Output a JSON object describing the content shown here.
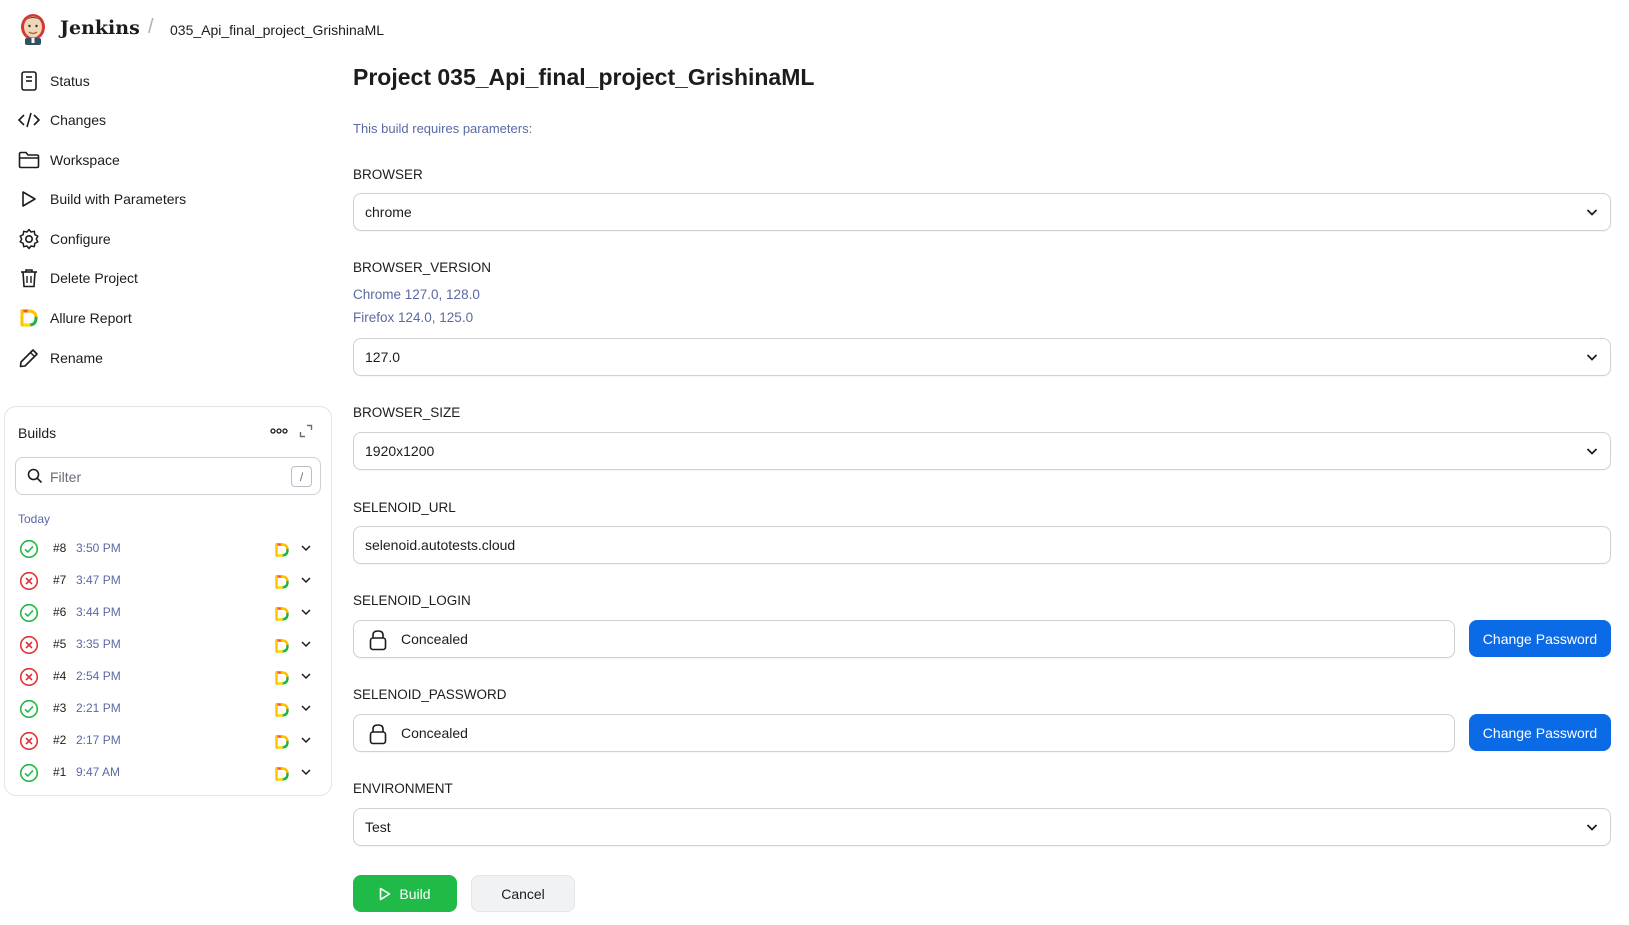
{
  "header": {
    "brand": "Jenkins",
    "breadcrumb_separator": "/",
    "breadcrumb": "035_Api_final_project_GrishinaML"
  },
  "sidebar": {
    "items": [
      {
        "label": "Status",
        "icon": "document-icon"
      },
      {
        "label": "Changes",
        "icon": "code-icon"
      },
      {
        "label": "Workspace",
        "icon": "folder-icon"
      },
      {
        "label": "Build with Parameters",
        "icon": "play-icon"
      },
      {
        "label": "Configure",
        "icon": "gear-icon"
      },
      {
        "label": "Delete Project",
        "icon": "trash-icon"
      },
      {
        "label": "Allure Report",
        "icon": "allure-icon"
      },
      {
        "label": "Rename",
        "icon": "pencil-icon"
      }
    ]
  },
  "builds": {
    "title": "Builds",
    "filter_placeholder": "Filter",
    "filter_shortcut": "/",
    "group_label": "Today",
    "items": [
      {
        "number": "#8",
        "time": "3:50 PM",
        "status": "success"
      },
      {
        "number": "#7",
        "time": "3:47 PM",
        "status": "failed"
      },
      {
        "number": "#6",
        "time": "3:44 PM",
        "status": "success"
      },
      {
        "number": "#5",
        "time": "3:35 PM",
        "status": "failed"
      },
      {
        "number": "#4",
        "time": "2:54 PM",
        "status": "failed"
      },
      {
        "number": "#3",
        "time": "2:21 PM",
        "status": "success"
      },
      {
        "number": "#2",
        "time": "2:17 PM",
        "status": "failed"
      },
      {
        "number": "#1",
        "time": "9:47 AM",
        "status": "success"
      }
    ]
  },
  "main": {
    "title": "Project 035_Api_final_project_GrishinaML",
    "requires_text": "This build requires parameters:",
    "params": {
      "browser": {
        "label": "BROWSER",
        "value": "chrome"
      },
      "browser_version": {
        "label": "BROWSER_VERSION",
        "description": [
          "Chrome 127.0, 128.0",
          "Firefox 124.0, 125.0"
        ],
        "value": "127.0"
      },
      "browser_size": {
        "label": "BROWSER_SIZE",
        "value": "1920x1200"
      },
      "selenoid_url": {
        "label": "SELENOID_URL",
        "value": "selenoid.autotests.cloud"
      },
      "selenoid_login": {
        "label": "SELENOID_LOGIN",
        "value": "Concealed",
        "button": "Change Password"
      },
      "selenoid_password": {
        "label": "SELENOID_PASSWORD",
        "value": "Concealed",
        "button": "Change Password"
      },
      "environment": {
        "label": "ENVIRONMENT",
        "value": "Test"
      }
    }
  },
  "actions": {
    "build": "Build",
    "cancel": "Cancel"
  },
  "colors": {
    "primary": "#0b6ae6",
    "success": "#1fba48",
    "failed": "#e0363a",
    "link": "#5a6aa3"
  }
}
